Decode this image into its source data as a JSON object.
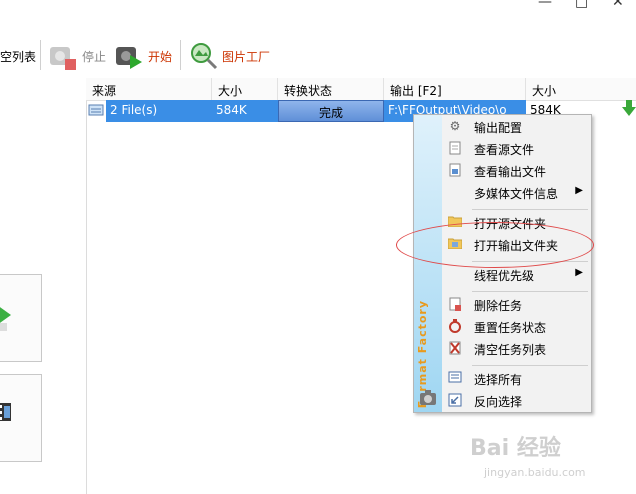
{
  "window": {
    "min_symbol": "—",
    "max_symbol": "□",
    "close_symbol": "✕"
  },
  "toolbar": {
    "clear_label": "空列表",
    "stop_label": "停止",
    "start_label": "开始",
    "picture_factory_label": "图片工厂"
  },
  "table": {
    "headers": [
      "来源",
      "大小",
      "转换状态",
      "输出 [F2]",
      "大小"
    ],
    "row": {
      "source": "2 File(s)",
      "size": "584K",
      "status": "完成",
      "output": "F:\\FFOutput\\Video\\o",
      "out_size": "584K"
    }
  },
  "context_menu": {
    "brand": "Format Factory",
    "items": [
      {
        "label": "输出配置",
        "icon": "gear-icon"
      },
      {
        "label": "查看源文件",
        "icon": "document-icon"
      },
      {
        "label": "查看输出文件",
        "icon": "output-document-icon"
      },
      {
        "label": "多媒体文件信息",
        "icon": "none",
        "submenu": true
      },
      {
        "label": "打开源文件夹",
        "icon": "folder-icon"
      },
      {
        "label": "打开输出文件夹",
        "icon": "folder-open-icon"
      },
      {
        "label": "线程优先级",
        "icon": "none",
        "submenu": true
      },
      {
        "label": "删除任务",
        "icon": "delete-document-icon"
      },
      {
        "label": "重置任务状态",
        "icon": "reset-icon"
      },
      {
        "label": "清空任务列表",
        "icon": "clear-list-icon"
      },
      {
        "label": "选择所有",
        "icon": "select-all-icon"
      },
      {
        "label": "反向选择",
        "icon": "invert-selection-icon"
      }
    ]
  },
  "colors": {
    "selection": "#3a8ee6",
    "annotation": "#e04a4a",
    "brand_text": "#e89a1d",
    "start_text": "#cc3300"
  },
  "watermark": {
    "text": "Bai 经验",
    "sub": "jingyan.baidu.com"
  }
}
